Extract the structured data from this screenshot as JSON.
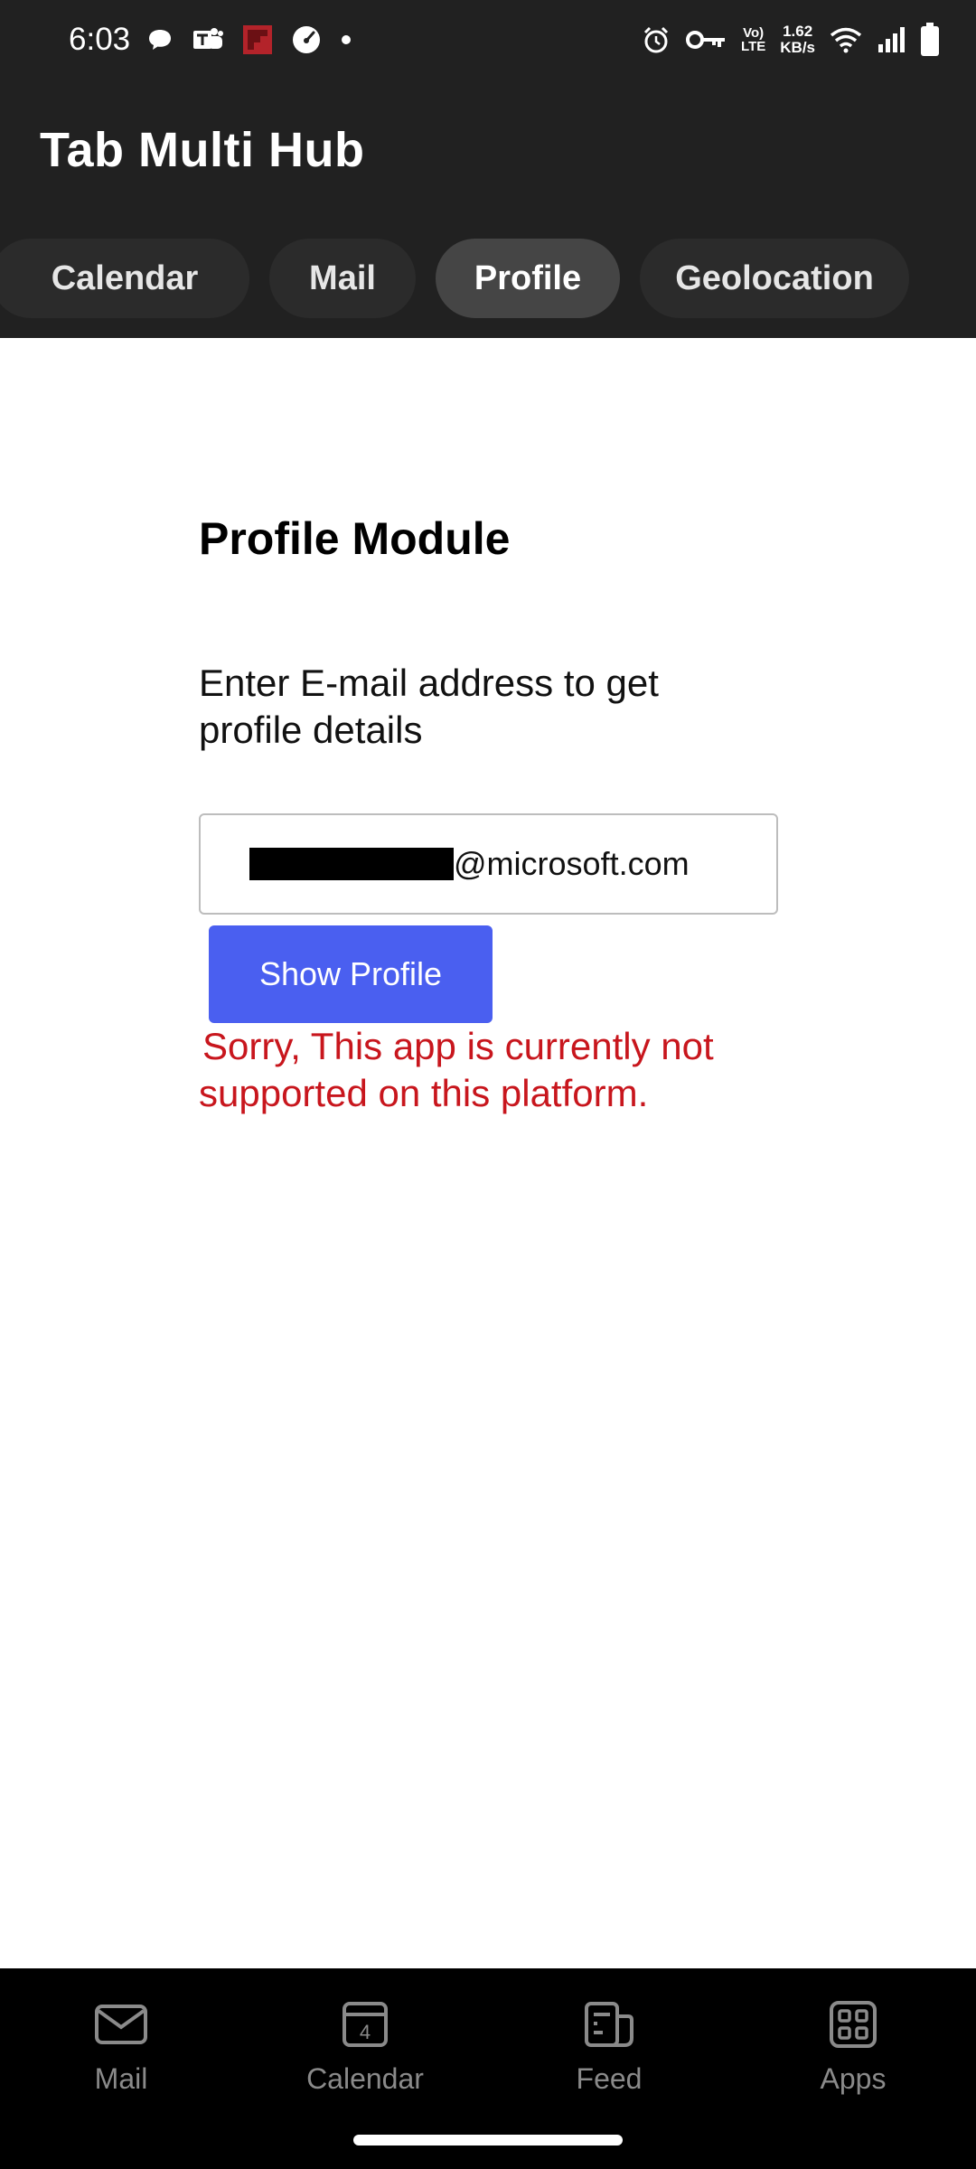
{
  "status_bar": {
    "time": "6:03",
    "network_type": "Vo) LTE",
    "network_type_top": "Vo)",
    "network_type_bottom": "LTE",
    "net_speed_value": "1.62",
    "net_speed_unit": "KB/s",
    "left_icons": [
      "chat-bubble-icon",
      "teams-icon",
      "flipboard-icon",
      "speedometer-icon",
      "dot-icon"
    ],
    "right_icons": [
      "alarm-icon",
      "vpn-key-icon",
      "volte-icon",
      "net-speed-icon",
      "wifi-icon",
      "signal-icon",
      "battery-icon"
    ]
  },
  "header": {
    "title": "Tab Multi Hub",
    "tabs": [
      {
        "label": "Calendar",
        "active": false
      },
      {
        "label": "Mail",
        "active": false
      },
      {
        "label": "Profile",
        "active": true
      },
      {
        "label": "Geolocation",
        "active": false
      }
    ]
  },
  "main": {
    "module_title": "Profile Module",
    "instruction": "Enter E-mail address to get profile details",
    "email_input": {
      "value_visible_suffix": "@microsoft.com",
      "redacted": true
    },
    "show_profile_label": "Show Profile",
    "error_message": "Sorry, This app is currently not supported on this platform."
  },
  "bottom_nav": {
    "items": [
      {
        "label": "Mail",
        "icon": "mail-icon"
      },
      {
        "label": "Calendar",
        "icon": "calendar-icon",
        "icon_text": "4"
      },
      {
        "label": "Feed",
        "icon": "feed-icon"
      },
      {
        "label": "Apps",
        "icon": "apps-icon"
      }
    ]
  },
  "colors": {
    "header_bg": "#212121",
    "tab_bg": "#2b2b2b",
    "tab_active_bg": "#454545",
    "button_bg": "#4a5ff0",
    "error_text": "#c8161d",
    "bottom_nav_bg": "#000000",
    "bottom_nav_text": "#8a8a8a"
  }
}
